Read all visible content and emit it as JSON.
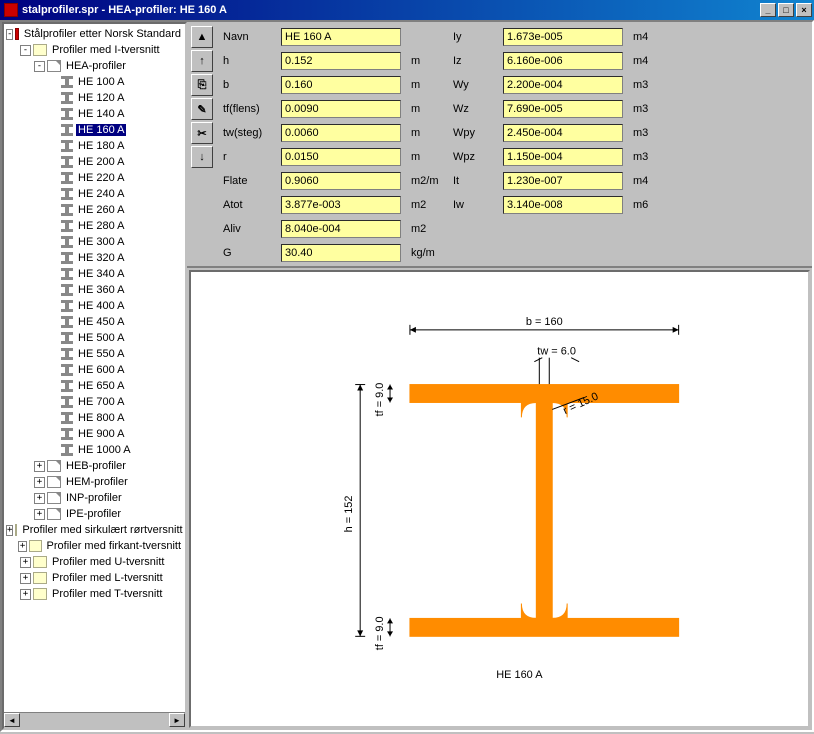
{
  "window": {
    "title": "stalprofiler.spr - HEA-profiler: HE 160 A"
  },
  "tree": {
    "root": "Stålprofiler etter Norsk Standard",
    "group1": "Profiler med I-tversnitt",
    "hea_group": "HEA-profiler",
    "hea": [
      "HE 100 A",
      "HE 120 A",
      "HE 140 A",
      "HE 160 A",
      "HE 180 A",
      "HE 200 A",
      "HE 220 A",
      "HE 240 A",
      "HE 260 A",
      "HE 280 A",
      "HE 300 A",
      "HE 320 A",
      "HE 340 A",
      "HE 360 A",
      "HE 400 A",
      "HE 450 A",
      "HE 500 A",
      "HE 550 A",
      "HE 600 A",
      "HE 650 A",
      "HE 700 A",
      "HE 800 A",
      "HE 900 A",
      "HE 1000 A"
    ],
    "selected": "HE 160 A",
    "other_i": [
      "HEB-profiler",
      "HEM-profiler",
      "INP-profiler",
      "IPE-profiler"
    ],
    "others": [
      "Profiler med sirkulært rørtversnitt",
      "Profiler med firkant-tversnitt",
      "Profiler med U-tversnitt",
      "Profiler med L-tversnitt",
      "Profiler med T-tversnitt"
    ]
  },
  "props": {
    "left": [
      {
        "label": "Navn",
        "value": "HE 160 A",
        "unit": ""
      },
      {
        "label": "h",
        "value": "0.152",
        "unit": "m"
      },
      {
        "label": "b",
        "value": "0.160",
        "unit": "m"
      },
      {
        "label": "tf(flens)",
        "value": "0.0090",
        "unit": "m"
      },
      {
        "label": "tw(steg)",
        "value": "0.0060",
        "unit": "m"
      },
      {
        "label": "r",
        "value": "0.0150",
        "unit": "m"
      },
      {
        "label": "Flate",
        "value": "0.9060",
        "unit": "m2/m"
      },
      {
        "label": "Atot",
        "value": "3.877e-003",
        "unit": "m2"
      },
      {
        "label": "Aliv",
        "value": "8.040e-004",
        "unit": "m2"
      },
      {
        "label": "G",
        "value": "30.40",
        "unit": "kg/m"
      }
    ],
    "right": [
      {
        "label": "Iy",
        "value": "1.673e-005",
        "unit": "m4"
      },
      {
        "label": "Iz",
        "value": "6.160e-006",
        "unit": "m4"
      },
      {
        "label": "Wy",
        "value": "2.200e-004",
        "unit": "m3"
      },
      {
        "label": "Wz",
        "value": "7.690e-005",
        "unit": "m3"
      },
      {
        "label": "Wpy",
        "value": "2.450e-004",
        "unit": "m3"
      },
      {
        "label": "Wpz",
        "value": "1.150e-004",
        "unit": "m3"
      },
      {
        "label": "It",
        "value": "1.230e-007",
        "unit": "m4"
      },
      {
        "label": "Iw",
        "value": "3.140e-008",
        "unit": "m6"
      }
    ]
  },
  "diagram": {
    "caption": "HE 160 A",
    "b_label": "b = 160",
    "h_label": "h = 152",
    "tw_label": "tw = 6.0",
    "tf_label_top": "tf = 9.0",
    "tf_label_bot": "tf = 9.0",
    "r_label": "r = 15.0"
  }
}
